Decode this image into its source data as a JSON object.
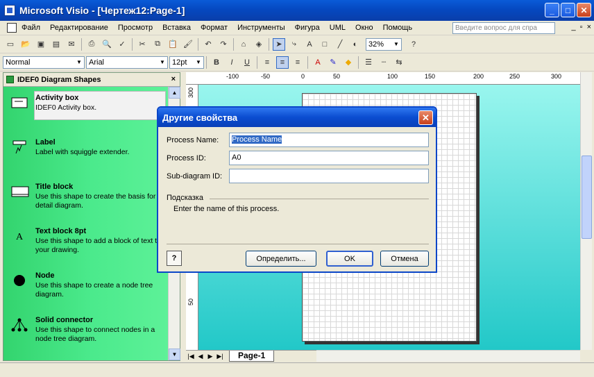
{
  "window": {
    "title": "Microsoft Visio - [Чертеж12:Page-1]",
    "btn_min": "_",
    "btn_max": "□",
    "btn_close": "✕"
  },
  "menu": {
    "items": [
      "Файл",
      "Редактирование",
      "Просмотр",
      "Вставка",
      "Формат",
      "Инструменты",
      "Фигура",
      "UML",
      "Окно",
      "Помощь"
    ],
    "help_placeholder": "Введите вопрос для спра",
    "mdi_min": "_",
    "mdi_restore": "▫",
    "mdi_close": "×"
  },
  "toolbar": {
    "zoom": "32%",
    "style": "Normal",
    "font": "Arial",
    "size": "12pt",
    "bold": "B",
    "italic": "I",
    "underline": "U"
  },
  "shapes": {
    "title": "IDEF0 Diagram Shapes",
    "close": "×",
    "items": [
      {
        "name": "Activity box",
        "desc": "IDEF0 Activity box."
      },
      {
        "name": "Label",
        "desc": "Label with squiggle extender."
      },
      {
        "name": "Title block",
        "desc": "Use this shape to create the basis for a detail diagram."
      },
      {
        "name": "Text block 8pt",
        "desc": "Use this shape to add a block of text to your drawing."
      },
      {
        "name": "Node",
        "desc": "Use this shape to create a node tree diagram."
      },
      {
        "name": "Solid connector",
        "desc": "Use this shape to connect nodes in a node tree diagram."
      }
    ]
  },
  "ruler": {
    "h_ticks": [
      "-100",
      "-50",
      "0",
      "50",
      "100",
      "150",
      "200",
      "250",
      "300"
    ],
    "v_ticks": [
      "300",
      "250",
      "200",
      "150",
      "100",
      "50"
    ]
  },
  "tabs": {
    "page": "Page-1"
  },
  "dialog": {
    "title": "Другие свойства",
    "process_name_label": "Process Name:",
    "process_name_value": "Process Name",
    "process_id_label": "Process ID:",
    "process_id_value": "A0",
    "subdiagram_label": "Sub-diagram ID:",
    "subdiagram_value": "",
    "hint_label": "Подсказка",
    "hint_text": "Enter the name of this process.",
    "help_button": "?",
    "define_button": "Определить...",
    "ok_button": "OK",
    "cancel_button": "Отмена"
  }
}
